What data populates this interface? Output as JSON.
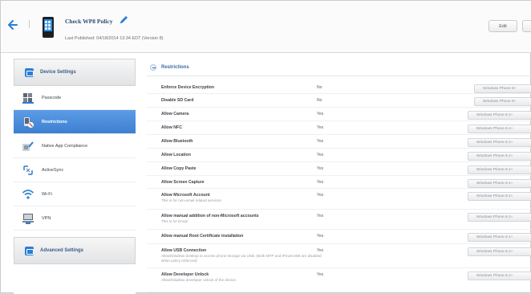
{
  "header": {
    "title": "Check WP8 Policy",
    "subtitle": "Last Published: 04/18/2014 13:34 EDT (Version 8)",
    "edit_label": "Edit"
  },
  "sidebar": {
    "device_settings_label": "Device Settings",
    "items": [
      {
        "label": "Passcode",
        "icon": "keypad-icon"
      },
      {
        "label": "Restrictions",
        "icon": "restriction-icon"
      },
      {
        "label": "Native App Compliance",
        "icon": "app-compliance-icon"
      },
      {
        "label": "ActiveSync",
        "icon": "sync-icon"
      },
      {
        "label": "Wi-Fi",
        "icon": "wifi-icon"
      },
      {
        "label": "VPN",
        "icon": "vpn-icon"
      }
    ],
    "advanced_settings_label": "Advanced Settings"
  },
  "main": {
    "section_title": "Restrictions",
    "rows": [
      {
        "label": "Enforce Device Encryption",
        "desc": "",
        "value": "No",
        "badge": "Windows Phone 8+"
      },
      {
        "label": "Disable SD Card",
        "desc": "",
        "value": "No",
        "badge": "Windows Phone 8+"
      },
      {
        "label": "Allow Camera",
        "desc": "",
        "value": "Yes",
        "badge": "Windows Phone 8.1+"
      },
      {
        "label": "Allow NFC",
        "desc": "",
        "value": "Yes",
        "badge": "Windows Phone 8.1+"
      },
      {
        "label": "Allow Bluetooth",
        "desc": "",
        "value": "Yes",
        "badge": "Windows Phone 8.1+"
      },
      {
        "label": "Allow Location",
        "desc": "",
        "value": "Yes",
        "badge": "Windows Phone 8.1+"
      },
      {
        "label": "Allow Copy Paste",
        "desc": "",
        "value": "Yes",
        "badge": "Windows Phone 8.1+"
      },
      {
        "label": "Allow Screen Capture",
        "desc": "",
        "value": "Yes",
        "badge": "Windows Phone 8.1+"
      },
      {
        "label": "Allow Microsoft Account",
        "desc": "This is for non-email related services",
        "value": "Yes",
        "badge": "Windows Phone 8.1+"
      },
      {
        "label": "Allow manual addition of non-Microsoft accounts",
        "desc": "This is for Email",
        "value": "Yes",
        "badge": "Windows Phone 8.1+"
      },
      {
        "label": "Allow manual Root Certificate installation",
        "desc": "",
        "value": "Yes",
        "badge": "Windows Phone 8.1+"
      },
      {
        "label": "Allow USB Connection",
        "desc": "Allow/Disallow desktop to access phone storage via USB. (Both MTP and IPoverUSB are disabled when policy enforced)",
        "value": "Yes",
        "badge": "Windows Phone 8.1+"
      },
      {
        "label": "Allow Developer Unlock",
        "desc": "Allow/Disallow developer unlock of the device.",
        "value": "Yes",
        "badge": "Windows Phone 8.1+"
      }
    ]
  },
  "colors": {
    "accent": "#3c7fd1",
    "title": "#2f4a70",
    "section": "#3a6aa8"
  }
}
